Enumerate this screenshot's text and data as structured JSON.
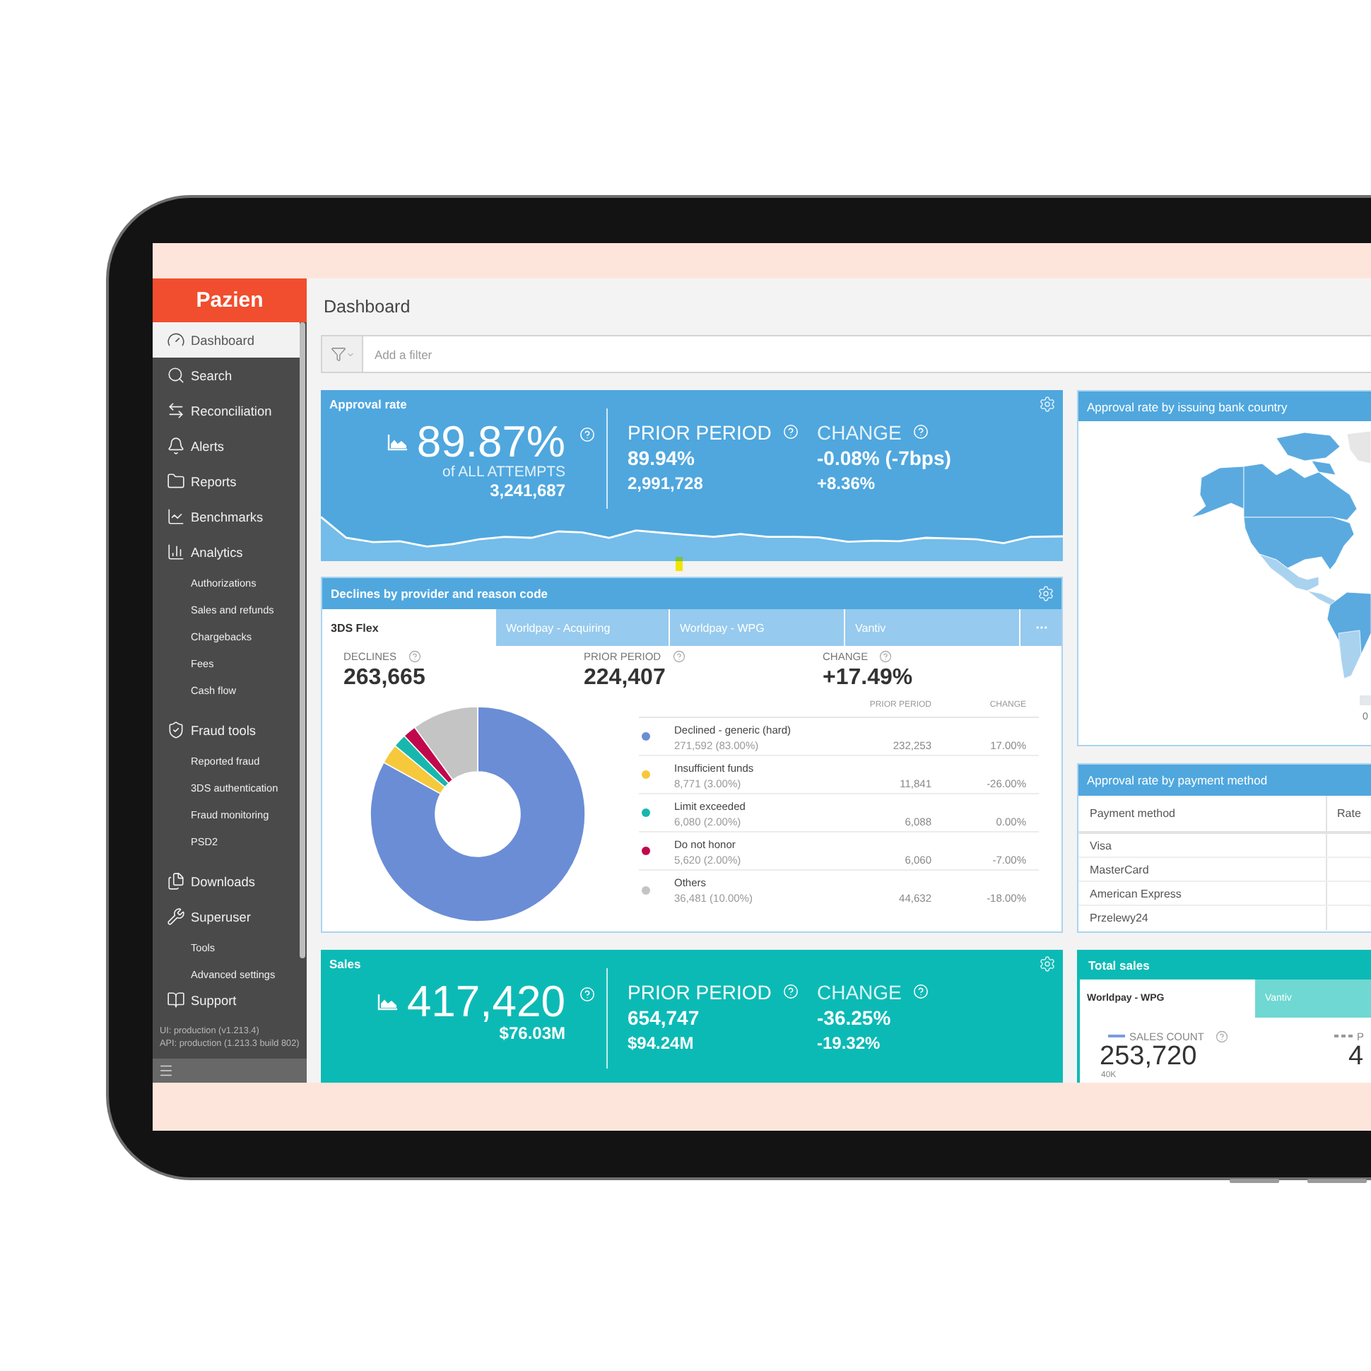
{
  "sidebar": {
    "logo": "Pazien",
    "items": [
      {
        "label": "Dashboard",
        "selected": true
      },
      {
        "label": "Search",
        "selected": false
      },
      {
        "label": "Reconciliation",
        "selected": false
      },
      {
        "label": "Alerts",
        "selected": false
      },
      {
        "label": "Reports",
        "selected": false
      },
      {
        "label": "Benchmarks",
        "selected": false
      },
      {
        "label": "Analytics",
        "selected": false,
        "children": [
          {
            "label": "Authorizations",
            "selected": false
          },
          {
            "label": "Sales and refunds",
            "selected": false
          },
          {
            "label": "Chargebacks",
            "selected": false
          },
          {
            "label": "Fees",
            "selected": false
          },
          {
            "label": "Cash flow",
            "selected": false
          }
        ]
      },
      {
        "label": "Fraud tools",
        "selected": false,
        "children": [
          {
            "label": "Reported fraud",
            "selected": false
          },
          {
            "label": "3DS authentication",
            "selected": false
          },
          {
            "label": "Fraud monitoring",
            "selected": false
          },
          {
            "label": "PSD2",
            "selected": false
          }
        ]
      },
      {
        "label": "Downloads",
        "selected": false
      },
      {
        "label": "Superuser",
        "selected": false,
        "children": [
          {
            "label": "Tools",
            "selected": false
          },
          {
            "label": "Advanced settings",
            "selected": false
          }
        ]
      }
    ],
    "footer_item": {
      "label": "Support",
      "selected": false
    },
    "version_lines": [
      "UI: production (v1.213.4)",
      "API: production (1.213.3 build 802)"
    ]
  },
  "page_title": "Dashboard",
  "filter": {
    "placeholder": "Add a filter"
  },
  "approval_rate_card": {
    "title": "Approval rate",
    "value": "89.87%",
    "caption": "of ALL ATTEMPTS",
    "detail": "3,241,687",
    "prior": {
      "label": "PRIOR PERIOD",
      "value": "89.94%",
      "detail": "2,991,728"
    },
    "change": {
      "label": "CHANGE",
      "value": "-0.08% (-7bps)",
      "detail": "+8.36%"
    }
  },
  "declines_card": {
    "title": "Declines by provider and reason code",
    "tabs": [
      {
        "label": "3DS Flex",
        "selected": true
      },
      {
        "label": "Worldpay - Acquiring",
        "selected": false
      },
      {
        "label": "Worldpay - WPG",
        "selected": false
      },
      {
        "label": "Vantiv",
        "selected": false
      }
    ],
    "stats": [
      {
        "label": "DECLINES",
        "value": "263,665"
      },
      {
        "label": "PRIOR PERIOD",
        "value": "224,407"
      },
      {
        "label": "CHANGE",
        "value": "+17.49%"
      }
    ],
    "chart_data": {
      "type": "donut",
      "categories": [
        "Declined - generic (hard)",
        "Insufficient funds",
        "Limit exceeded",
        "Do not honor",
        "Others"
      ],
      "values": [
        83,
        3,
        2,
        2,
        10
      ]
    },
    "columns": [
      "PRIOR PERIOD",
      "CHANGE"
    ],
    "rows": [
      {
        "count": "271,592 (83.00%)",
        "prior": "232,253",
        "change": "17.00%",
        "color": "#6b8dd6"
      },
      {
        "count": "8,771 (3.00%)",
        "prior": "11,841",
        "change": "-26.00%",
        "color": "#f6c83c"
      },
      {
        "count": "6,080 (2.00%)",
        "prior": "6,088",
        "change": "0.00%",
        "color": "#18b7ae"
      },
      {
        "count": "5,620 (2.00%)",
        "prior": "6,060",
        "change": "-7.00%",
        "color": "#c0094c"
      },
      {
        "count": "36,481 (10.00%)",
        "prior": "44,632",
        "change": "-18.00%",
        "color": "#c4c4c4"
      }
    ]
  },
  "sales_card": {
    "title": "Sales",
    "value": "417,420",
    "detail": "$76.03M",
    "prior": {
      "label": "PRIOR PERIOD",
      "value": "654,747",
      "detail": "$94.24M"
    },
    "change": {
      "label": "CHANGE",
      "value": "-36.25%",
      "detail": "-19.32%"
    }
  },
  "map_card": {
    "title": "Approval rate by issuing bank country",
    "legend_min": "0"
  },
  "payment_method_card": {
    "title": "Approval rate by payment method",
    "columns": [
      "Payment method",
      "Rate"
    ],
    "rows": [
      {
        "method": "Visa"
      },
      {
        "method": "MasterCard"
      },
      {
        "method": "American Express"
      },
      {
        "method": "Przelewy24"
      }
    ]
  },
  "total_sales_card": {
    "title": "Total sales",
    "tabs": [
      {
        "label": "Worldpay - WPG",
        "selected": true
      },
      {
        "label": "Vantiv",
        "selected": false
      }
    ],
    "series": [
      {
        "kind": "solid",
        "label": "SALES COUNT",
        "value": "253,720",
        "help_icon": true
      },
      {
        "kind": "dashed",
        "label": "P",
        "value": "4"
      }
    ],
    "axis_label": "40K"
  }
}
